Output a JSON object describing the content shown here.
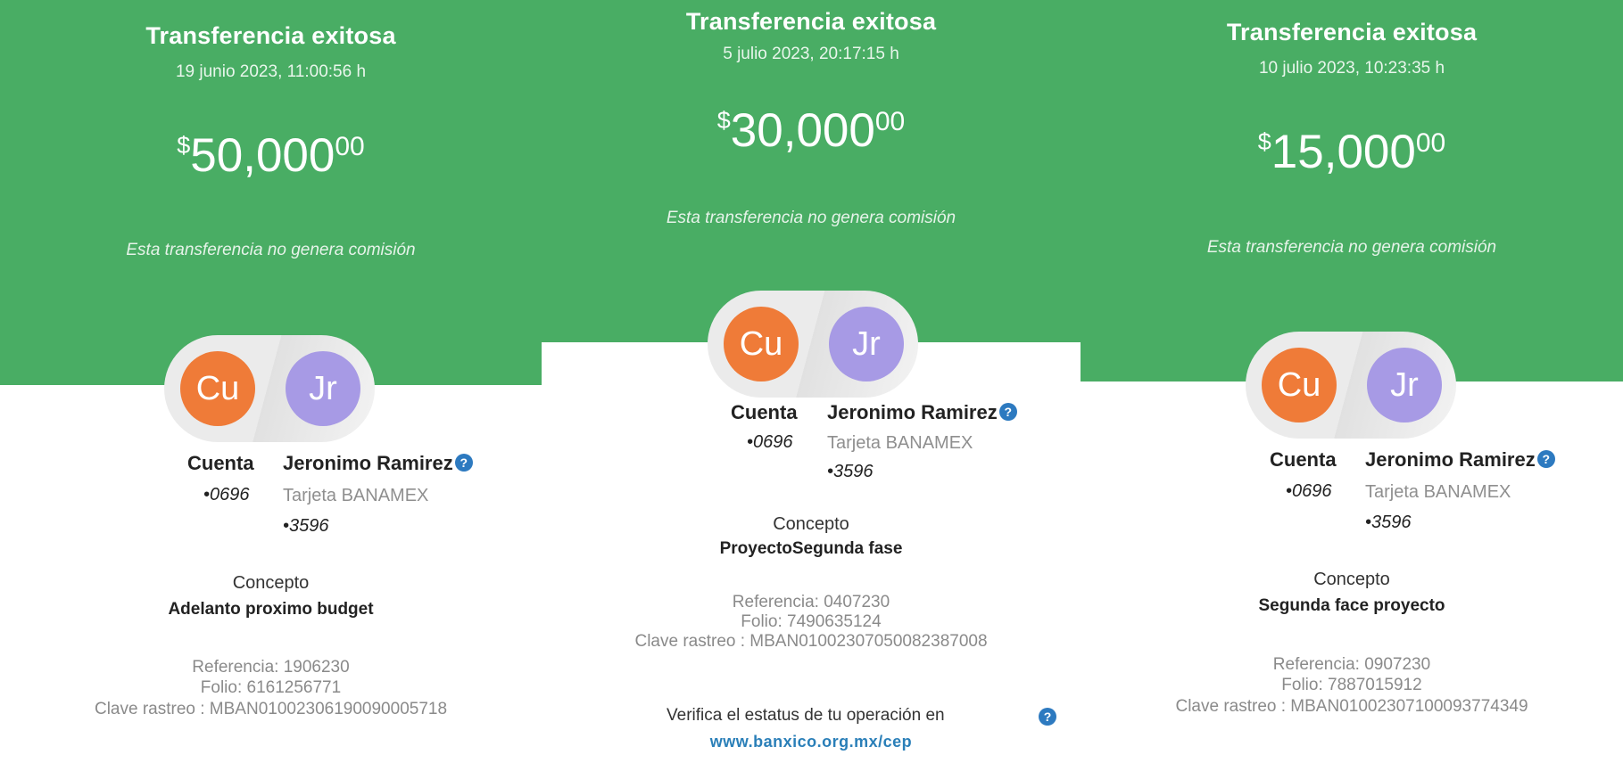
{
  "receipts": [
    {
      "title": "Transferencia exitosa",
      "datetime": "19 junio 2023, 11:00:56 h",
      "amount_symbol": "$",
      "amount_main": "50,000",
      "amount_cents": "00",
      "fee_note": "Esta transferencia no genera comisión",
      "origin_initials": "Cu",
      "dest_initials": "Jr",
      "origin_label": "Cuenta",
      "origin_account": "•0696",
      "dest_name": "Jeronimo Ramirez",
      "dest_bank": "Tarjeta BANAMEX",
      "dest_account": "•3596",
      "concepto_label": "Concepto",
      "concepto_value": "Adelanto proximo budget",
      "referencia": "Referencia: 1906230",
      "folio": "Folio: 6161256771",
      "clave": "Clave rastreo : MBAN01002306190090005718"
    },
    {
      "title": "Transferencia exitosa",
      "datetime": "5 julio 2023, 20:17:15 h",
      "amount_symbol": "$",
      "amount_main": "30,000",
      "amount_cents": "00",
      "fee_note": "Esta transferencia no genera comisión",
      "origin_initials": "Cu",
      "dest_initials": "Jr",
      "origin_label": "Cuenta",
      "origin_account": "•0696",
      "dest_name": "Jeronimo Ramirez",
      "dest_bank": "Tarjeta BANAMEX",
      "dest_account": "•3596",
      "concepto_label": "Concepto",
      "concepto_value": "ProyectoSegunda fase",
      "referencia": "Referencia: 0407230",
      "folio": "Folio: 7490635124",
      "clave": "Clave rastreo : MBAN01002307050082387008",
      "verify_text": "Verifica el estatus de tu operación en",
      "verify_link": "www.banxico.org.mx/cep"
    },
    {
      "title": "Transferencia exitosa",
      "datetime": "10 julio 2023, 10:23:35 h",
      "amount_symbol": "$",
      "amount_main": "15,000",
      "amount_cents": "00",
      "fee_note": "Esta transferencia no genera comisión",
      "origin_initials": "Cu",
      "dest_initials": "Jr",
      "origin_label": "Cuenta",
      "origin_account": "•0696",
      "dest_name": "Jeronimo Ramirez",
      "dest_bank": "Tarjeta BANAMEX",
      "dest_account": "•3596",
      "concepto_label": "Concepto",
      "concepto_value": "Segunda face proyecto",
      "referencia": "Referencia: 0907230",
      "folio": "Folio: 7887015912",
      "clave": "Clave rastreo : MBAN01002307100093774349"
    }
  ],
  "help_icon_glyph": "?",
  "colors": {
    "header_green": "#49ad64",
    "origin_avatar": "#ef7b38",
    "dest_avatar": "#a79ae5",
    "help_icon": "#2d7ac0",
    "link": "#2a7fb8"
  }
}
